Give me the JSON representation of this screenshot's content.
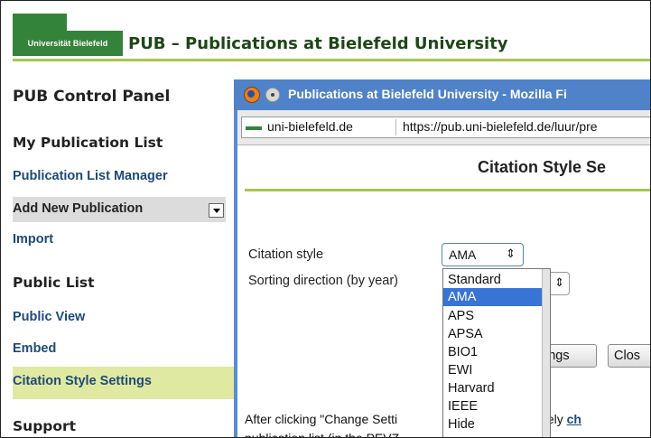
{
  "header": {
    "logo_text": "Universität Bielefeld",
    "site_title": "PUB – Publications at Bielefeld University"
  },
  "sidebar": {
    "control_panel_heading": "PUB Control Panel",
    "my_list_heading": "My Publication List",
    "items_my": [
      {
        "label": "Publication List Manager"
      },
      {
        "label": "Add New Publication"
      },
      {
        "label": "Import"
      }
    ],
    "public_heading": "Public List",
    "items_public": [
      {
        "label": "Public View"
      },
      {
        "label": "Embed"
      },
      {
        "label": "Citation Style Settings"
      }
    ],
    "support_heading": "Support",
    "active_item": "Citation Style Settings",
    "active_color": "#dfe9a2"
  },
  "popup": {
    "window_title": "Publications at Bielefeld University - Mozilla Fi",
    "site_name": "uni-bielefeld.de",
    "url": "https://pub.uni-bielefeld.de/luur/pre",
    "page_heading": "Citation Style Se",
    "citation_style_label": "Citation style",
    "citation_style_value": "AMA",
    "sorting_label": "Sorting direction (by year)",
    "dropdown_options": [
      "Standard",
      "AMA",
      "APS",
      "APSA",
      "BIO1",
      "EWI",
      "Harvard",
      "IEEE",
      "Hide"
    ],
    "dropdown_selected": "AMA",
    "change_button_label": "ings",
    "close_button_label": "Clos",
    "info_line1_a": "After clicking \"Change Setti",
    "info_line1_b": "mmediately ",
    "info_line1_link": "ch",
    "info_line2": "publication list (in the PEVZ"
  }
}
